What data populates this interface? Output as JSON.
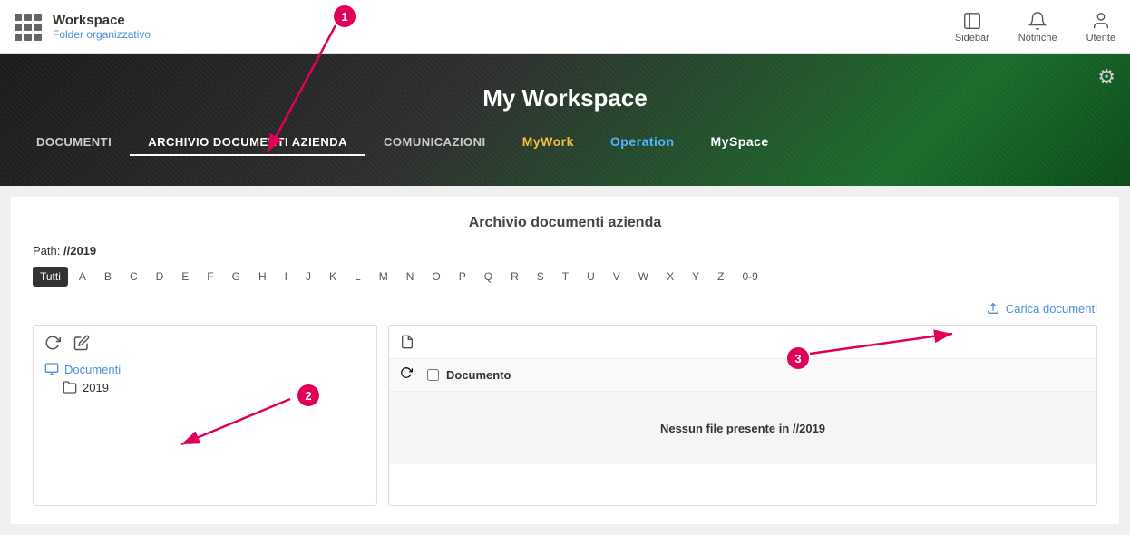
{
  "topbar": {
    "title": "Workspace",
    "subtitle": "Folder organizzativo",
    "actions": [
      {
        "id": "sidebar",
        "label": "Sidebar"
      },
      {
        "id": "notifiche",
        "label": "Notifiche"
      },
      {
        "id": "utente",
        "label": "Utente"
      }
    ]
  },
  "hero": {
    "title": "My Workspace",
    "settings_icon": "⚙",
    "tabs": [
      {
        "id": "documenti",
        "label": "DOCUMENTI",
        "active": false
      },
      {
        "id": "archivio",
        "label": "ARCHIVIO DOCUMENTI AZIENDA",
        "active": true
      },
      {
        "id": "comunicazioni",
        "label": "COMUNICAZIONI",
        "active": false
      },
      {
        "id": "mywork",
        "label": "MyWork",
        "active": false,
        "color": "yellow"
      },
      {
        "id": "operation",
        "label": "Operation",
        "active": false,
        "color": "blue"
      },
      {
        "id": "myspace",
        "label": "MySpace",
        "active": false,
        "color": "white"
      }
    ]
  },
  "main": {
    "section_title": "Archivio documenti azienda",
    "path_label": "Path:",
    "path_value": "//2019",
    "alphabet": [
      "Tutti",
      "A",
      "B",
      "C",
      "D",
      "E",
      "F",
      "G",
      "H",
      "I",
      "J",
      "K",
      "L",
      "M",
      "N",
      "O",
      "P",
      "Q",
      "R",
      "S",
      "T",
      "U",
      "V",
      "W",
      "X",
      "Y",
      "Z",
      "0-9"
    ],
    "active_alpha": "Tutti",
    "upload_label": "Carica documenti",
    "left_panel": {
      "tree": [
        {
          "label": "Documenti",
          "level": 0
        },
        {
          "label": "2019",
          "level": 1
        }
      ]
    },
    "right_panel": {
      "col_label": "Documento",
      "empty_message": "Nessun file presente in //2019"
    }
  },
  "annotations": [
    {
      "id": "1",
      "label": "1"
    },
    {
      "id": "2",
      "label": "2"
    },
    {
      "id": "3",
      "label": "3"
    }
  ]
}
